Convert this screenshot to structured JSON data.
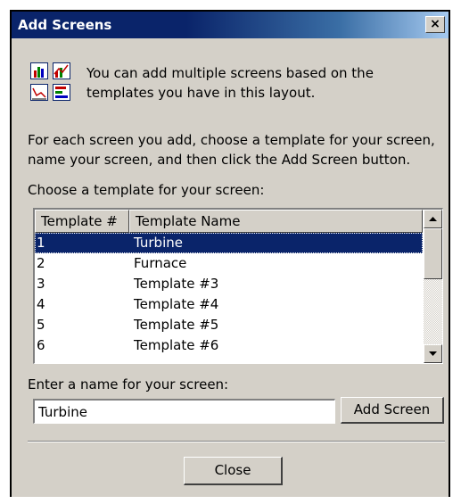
{
  "window": {
    "title": "Add Screens",
    "close_glyph": "×"
  },
  "icons": [
    "bar-chart-icon",
    "line-chart-icon",
    "trend-chart-icon",
    "horizontal-bar-chart-icon"
  ],
  "intro": "You can add multiple screens based on the templates you have in this layout.",
  "instructions": "For each screen you add, choose a template for your screen, name your screen, and then click the Add Screen button.",
  "template_list": {
    "label": "Choose a template for your screen:",
    "columns": [
      "Template #",
      "Template Name"
    ],
    "rows": [
      {
        "num": "1",
        "name": "Turbine",
        "selected": true
      },
      {
        "num": "2",
        "name": "Furnace"
      },
      {
        "num": "3",
        "name": "Template #3"
      },
      {
        "num": "4",
        "name": "Template #4"
      },
      {
        "num": "5",
        "name": "Template #5"
      },
      {
        "num": "6",
        "name": "Template #6"
      }
    ]
  },
  "name_field": {
    "label": "Enter a name for your screen:",
    "value": "Turbine"
  },
  "buttons": {
    "add": "Add Screen",
    "close": "Close"
  },
  "colors": {
    "title_bar": "#0a246a",
    "selection": "#0a246a",
    "face": "#d4d0c8"
  }
}
